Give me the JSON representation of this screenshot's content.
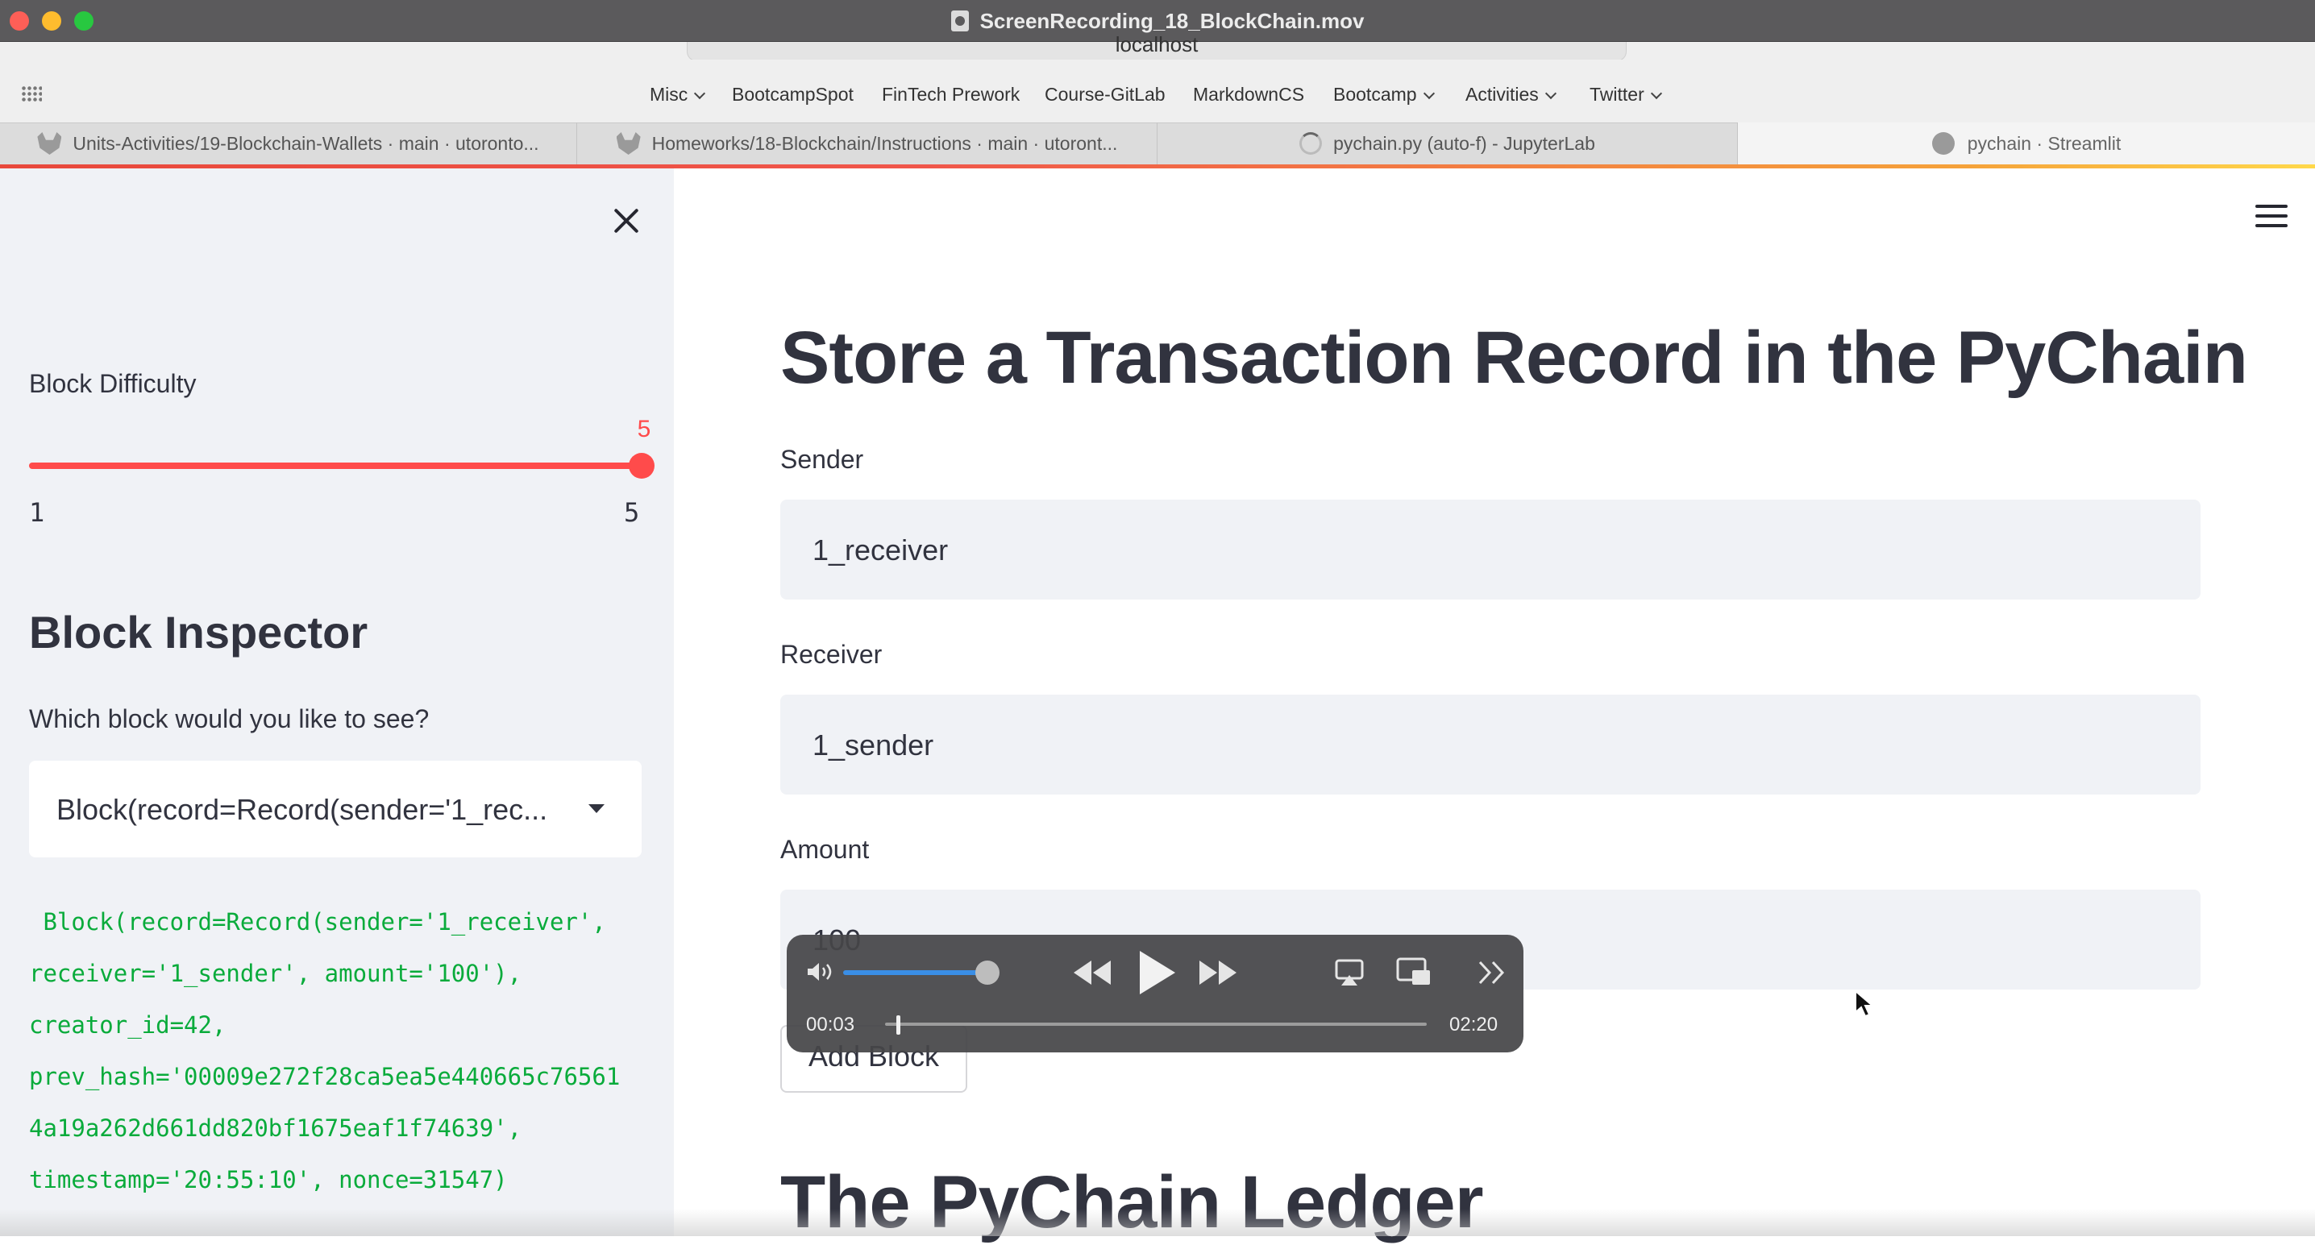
{
  "window": {
    "title": "ScreenRecording_18_BlockChain.mov"
  },
  "browser": {
    "url": "localhost",
    "bookmarks": [
      {
        "label": "Misc",
        "dropdown": true
      },
      {
        "label": "BootcampSpot",
        "dropdown": false
      },
      {
        "label": "FinTech Prework",
        "dropdown": false
      },
      {
        "label": "Course-GitLab",
        "dropdown": false
      },
      {
        "label": "MarkdownCS",
        "dropdown": false
      },
      {
        "label": "Bootcamp",
        "dropdown": true
      },
      {
        "label": "Activities",
        "dropdown": true
      },
      {
        "label": "Twitter",
        "dropdown": true
      }
    ],
    "tabs": [
      {
        "label": "Units-Activities/19-Blockchain-Wallets · main · utoronto...",
        "icon": "gitlab-icon"
      },
      {
        "label": "Homeworks/18-Blockchain/Instructions · main · utoront...",
        "icon": "gitlab-icon"
      },
      {
        "label": "pychain.py (auto-f) - JupyterLab",
        "icon": "loading-spinner-icon"
      },
      {
        "label": "pychain · Streamlit",
        "icon": "streamlit-icon",
        "active": true
      }
    ]
  },
  "sidebar": {
    "difficulty_label": "Block Difficulty",
    "slider": {
      "value": "5",
      "min": "1",
      "max": "5",
      "fraction": 1.0,
      "color": "#ff4b4b"
    },
    "inspector_title": "Block Inspector",
    "question": "Which block would you like to see?",
    "selected_block": "Block(record=Record(sender='1_rec...",
    "code_lines": [
      " Block(record=Record(sender='1_receiver',",
      "receiver='1_sender', amount='100'),",
      "creator_id=42,",
      "prev_hash='00009e272f28ca5ea5e440665c76561",
      "4a19a262d661dd820bf1675eaf1f74639',",
      "timestamp='20:55:10', nonce=31547)"
    ],
    "code_color": "#09ab3b"
  },
  "main": {
    "title": "Store a Transaction Record in the PyChain",
    "sender_label": "Sender",
    "sender_value": "1_receiver",
    "receiver_label": "Receiver",
    "receiver_value": "1_sender",
    "amount_label": "Amount",
    "amount_value": "100",
    "add_button": "Add Block",
    "ledger_title": "The PyChain Ledger"
  },
  "player": {
    "current_time": "00:03",
    "total_time": "02:20",
    "volume_fraction": 0.85,
    "progress_fraction": 0.02
  }
}
